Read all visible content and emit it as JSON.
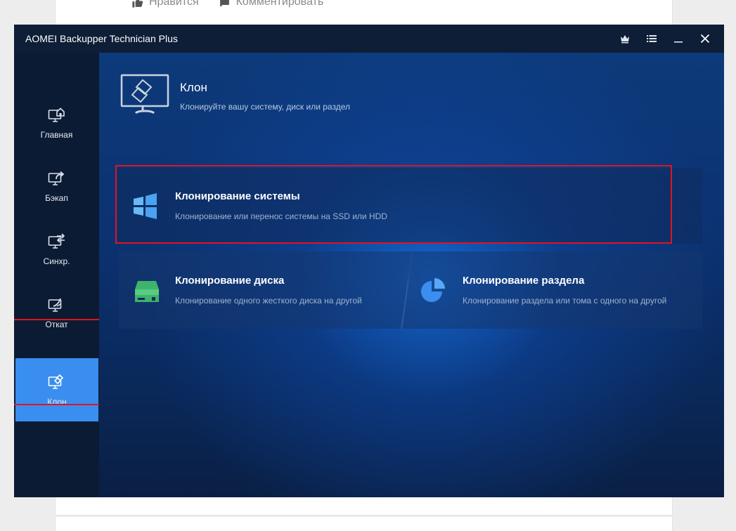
{
  "background_page": {
    "like_label": "Нравится",
    "comment_label": "Комментировать"
  },
  "window": {
    "title": "AOMEI Backupper Technician Plus",
    "controls": [
      "crown-icon",
      "menu-icon",
      "minimize-icon",
      "close-icon"
    ]
  },
  "sidebar": {
    "items": [
      {
        "label": "Главная",
        "icon": "home-monitor-icon"
      },
      {
        "label": "Бэкап",
        "icon": "backup-monitor-icon"
      },
      {
        "label": "Синхр.",
        "icon": "sync-monitor-icon"
      },
      {
        "label": "Откат",
        "icon": "restore-monitor-icon"
      },
      {
        "label": "Клон",
        "icon": "clone-monitor-icon",
        "active": true
      }
    ]
  },
  "header": {
    "title": "Клон",
    "subtitle": "Клонируйте вашу систему, диск или раздел"
  },
  "options": {
    "system": {
      "title": "Клонирование системы",
      "desc": "Клонирование или перенос системы на SSD или HDD"
    },
    "disk": {
      "title": "Клонирование диска",
      "desc": "Клонирование одного жесткого диска на другой"
    },
    "partition": {
      "title": "Клонирование раздела",
      "desc": "Клонирование раздела или тома с одного на другой"
    }
  },
  "colors": {
    "accent": "#3a8ef0",
    "highlight": "#e0141e",
    "titlebar": "#0d1e36",
    "sidebar": "#0b1b33"
  }
}
